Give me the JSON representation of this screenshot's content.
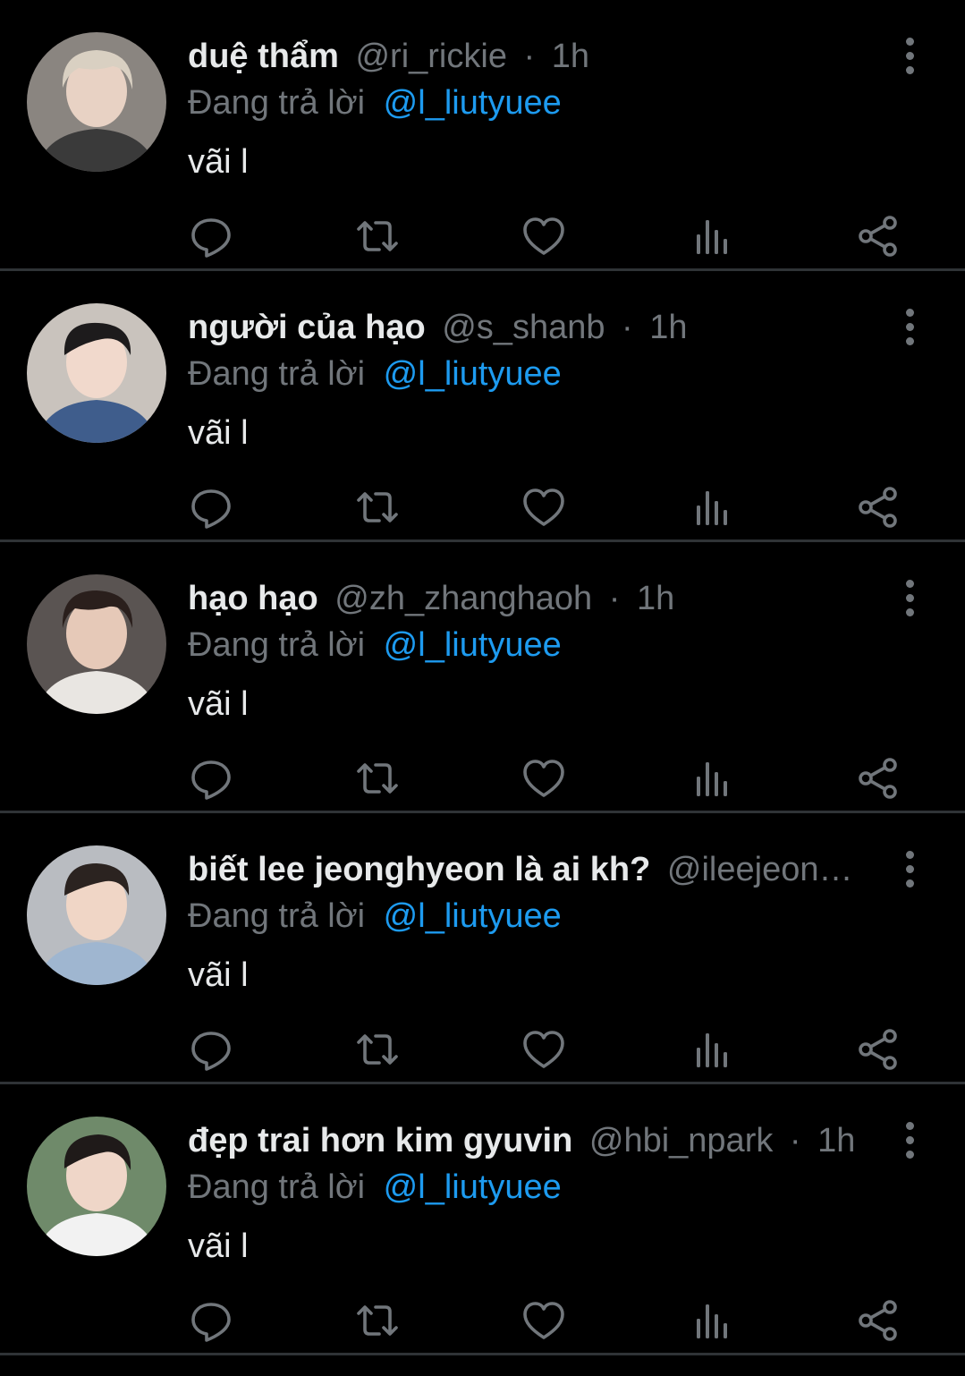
{
  "theme": {
    "background": "#000000",
    "text_primary": "#e7e9ea",
    "text_secondary": "#71767b",
    "accent": "#1d9bf0",
    "divider": "#2f3336"
  },
  "reply_prefix": "Đang trả lời",
  "tweets": [
    {
      "display_name": "duệ thẩm",
      "handle": "@ri_rickie",
      "separator": "·",
      "time": "1h",
      "reply_to": "@l_liutyuee",
      "text": "vãi l",
      "avatar_icon": "avatar-photo"
    },
    {
      "display_name": "người của hạo",
      "handle": "@s_shanb",
      "separator": "·",
      "time": "1h",
      "reply_to": "@l_liutyuee",
      "text": "vãi l",
      "avatar_icon": "avatar-photo"
    },
    {
      "display_name": "hạo hạo",
      "handle": "@zh_zhanghaoh",
      "separator": "·",
      "time": "1h",
      "reply_to": "@l_liutyuee",
      "text": "vãi l",
      "avatar_icon": "avatar-photo"
    },
    {
      "display_name": "biết lee jeonghyeon là ai kh?",
      "handle": "@ileejeon…",
      "separator": "",
      "time": "",
      "reply_to": "@l_liutyuee",
      "text": "vãi l",
      "avatar_icon": "avatar-photo"
    },
    {
      "display_name": "đẹp trai hơn kim gyuvin",
      "handle": "@hbi_npark",
      "separator": "·",
      "time": "1h",
      "reply_to": "@l_liutyuee",
      "text": "vãi l",
      "avatar_icon": "avatar-photo"
    }
  ],
  "action_icons": [
    "reply-icon",
    "retweet-icon",
    "like-icon",
    "views-icon",
    "share-icon"
  ],
  "more_icon": "more-vertical-icon"
}
